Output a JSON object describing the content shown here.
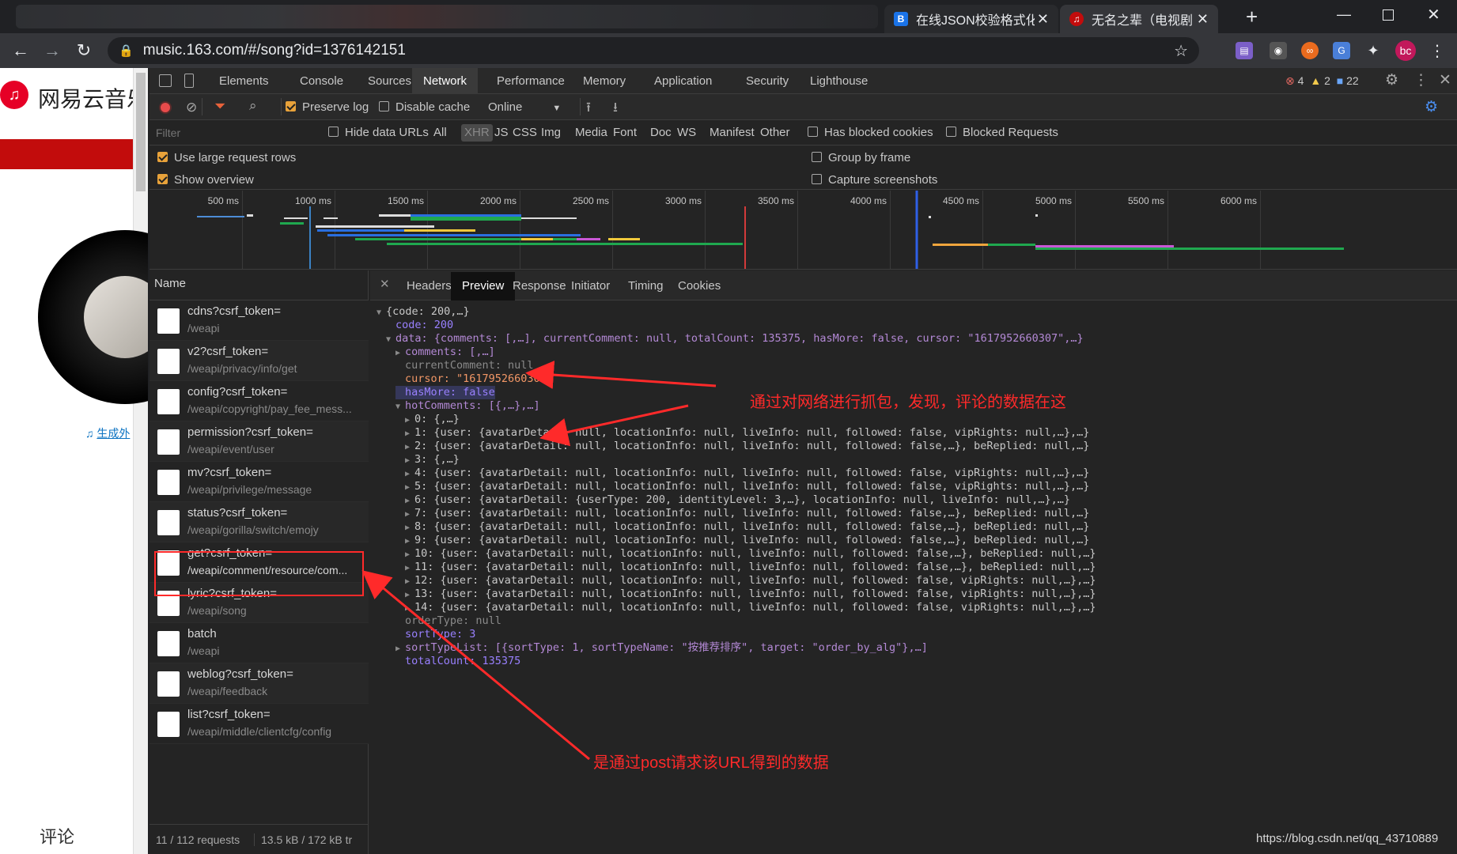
{
  "browser": {
    "tabs": [
      {
        "title": "在线JSON校验格式化",
        "favicon_text": "B",
        "favicon_color": "#1a73e8"
      },
      {
        "title": "无名之辈（电视剧",
        "favicon_text": "♫",
        "favicon_color": "#c20c0c"
      }
    ],
    "url": "music.163.com/#/song?id=1376142151",
    "profile_initials": "bc"
  },
  "page": {
    "logo_text": "网易云音乐",
    "generate_link": "生成外",
    "comment_heading": "评论"
  },
  "devtools": {
    "tabs": [
      "Elements",
      "Console",
      "Sources",
      "Network",
      "Performance",
      "Memory",
      "Application",
      "Security",
      "Lighthouse"
    ],
    "active_tab": "Network",
    "error_count": "4",
    "warning_count": "2",
    "info_count": "22",
    "toolbar": {
      "preserve_log": "Preserve log",
      "disable_cache": "Disable cache",
      "throttle": "Online"
    },
    "filter": {
      "placeholder": "Filter",
      "hide_data_urls": "Hide data URLs",
      "types": [
        "All",
        "XHR",
        "JS",
        "CSS",
        "Img",
        "Media",
        "Font",
        "Doc",
        "WS",
        "Manifest",
        "Other"
      ],
      "active_type": "XHR",
      "has_blocked_cookies": "Has blocked cookies",
      "blocked_requests": "Blocked Requests"
    },
    "settings": {
      "large_rows": "Use large request rows",
      "show_overview": "Show overview",
      "group_by_frame": "Group by frame",
      "capture_screenshots": "Capture screenshots"
    },
    "timeline_ticks": [
      "500 ms",
      "1000 ms",
      "1500 ms",
      "2000 ms",
      "2500 ms",
      "3000 ms",
      "3500 ms",
      "4000 ms",
      "4500 ms",
      "5000 ms",
      "5500 ms",
      "6000 ms"
    ],
    "name_header": "Name",
    "requests": [
      {
        "name": "cdns?csrf_token=",
        "path": "/weapi"
      },
      {
        "name": "v2?csrf_token=",
        "path": "/weapi/privacy/info/get"
      },
      {
        "name": "config?csrf_token=",
        "path": "/weapi/copyright/pay_fee_mess..."
      },
      {
        "name": "permission?csrf_token=",
        "path": "/weapi/event/user"
      },
      {
        "name": "mv?csrf_token=",
        "path": "/weapi/privilege/message"
      },
      {
        "name": "status?csrf_token=",
        "path": "/weapi/gorilla/switch/emojy"
      },
      {
        "name": "get?csrf_token=",
        "path": "/weapi/comment/resource/com..."
      },
      {
        "name": "lyric?csrf_token=",
        "path": "/weapi/song"
      },
      {
        "name": "batch",
        "path": "/weapi"
      },
      {
        "name": "weblog?csrf_token=",
        "path": "/weapi/feedback"
      },
      {
        "name": "list?csrf_token=",
        "path": "/weapi/middle/clientcfg/config"
      }
    ],
    "status_bar": {
      "requests": "11 / 112 requests",
      "transferred": "13.5 kB / 172 kB tr"
    },
    "detail_tabs": [
      "Headers",
      "Preview",
      "Response",
      "Initiator",
      "Timing",
      "Cookies"
    ],
    "active_detail_tab": "Preview",
    "preview_lines": [
      "{code: 200,…}",
      "code: 200",
      "data: {comments: [,…], currentComment: null, totalCount: 135375, hasMore: false, cursor: \"1617952660307\",…}",
      "comments: [,…]",
      "currentComment: null",
      "cursor: \"1617952660307\"",
      "hasMore: false",
      "hotComments: [{,…},…]",
      "0: {,…}",
      "1: {user: {avatarDetail: null, locationInfo: null, liveInfo: null, followed: false, vipRights: null,…},…}",
      "2: {user: {avatarDetail: null, locationInfo: null, liveInfo: null, followed: false,…}, beReplied: null,…}",
      "3: {,…}",
      "4: {user: {avatarDetail: null, locationInfo: null, liveInfo: null, followed: false, vipRights: null,…},…}",
      "5: {user: {avatarDetail: null, locationInfo: null, liveInfo: null, followed: false, vipRights: null,…},…}",
      "6: {user: {avatarDetail: {userType: 200, identityLevel: 3,…}, locationInfo: null, liveInfo: null,…},…}",
      "7: {user: {avatarDetail: null, locationInfo: null, liveInfo: null, followed: false,…}, beReplied: null,…}",
      "8: {user: {avatarDetail: null, locationInfo: null, liveInfo: null, followed: false,…}, beReplied: null,…}",
      "9: {user: {avatarDetail: null, locationInfo: null, liveInfo: null, followed: false,…}, beReplied: null,…}",
      "10: {user: {avatarDetail: null, locationInfo: null, liveInfo: null, followed: false,…}, beReplied: null,…}",
      "11: {user: {avatarDetail: null, locationInfo: null, liveInfo: null, followed: false,…}, beReplied: null,…}",
      "12: {user: {avatarDetail: null, locationInfo: null, liveInfo: null, followed: false, vipRights: null,…},…}",
      "13: {user: {avatarDetail: null, locationInfo: null, liveInfo: null, followed: false, vipRights: null,…},…}",
      "14: {user: {avatarDetail: null, locationInfo: null, liveInfo: null, followed: false, vipRights: null,…},…}",
      "orderType: null",
      "sortType: 3",
      "sortTypeList: [{sortType: 1, sortTypeName: \"按推荐排序\", target: \"order_by_alg\"},…]",
      "totalCount: 135375"
    ]
  },
  "annotations": {
    "top": "通过对网络进行抓包，发现，评论的数据在这",
    "bottom": "是通过post请求该URL得到的数据",
    "color": "#ff2a2a"
  },
  "watermark": "https://blog.csdn.net/qq_43710889"
}
